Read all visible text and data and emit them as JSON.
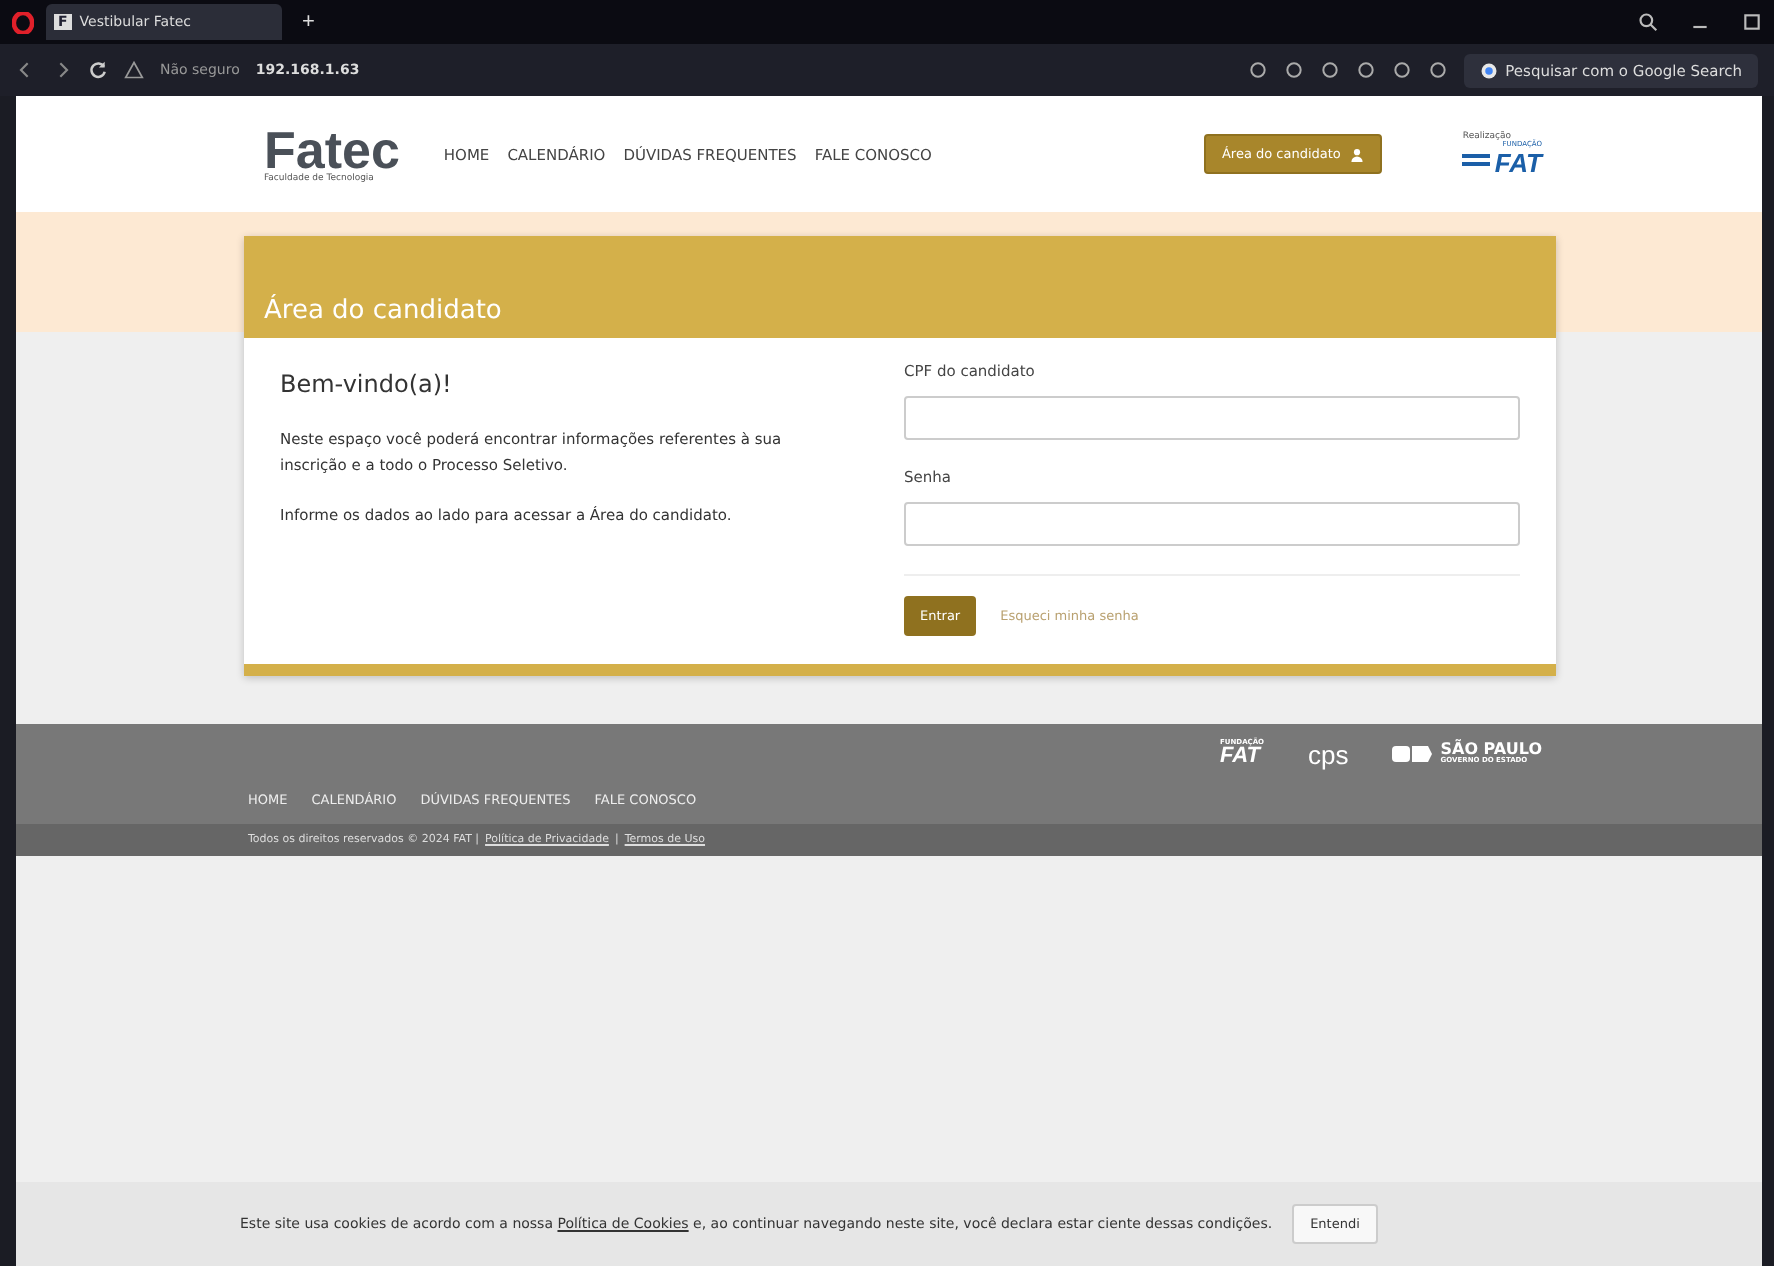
{
  "browser": {
    "tab_title": "Vestibular Fatec",
    "tab_icon": "F",
    "new_tab": "+",
    "security": "Não seguro",
    "address": "192.168.1.63",
    "search_button": "Pesquisar com o Google Search"
  },
  "header": {
    "logo": "Fatec",
    "logo_subtitle": "Faculdade de Tecnologia",
    "nav": [
      "HOME",
      "CALENDÁRIO",
      "DÚVIDAS FREQUENTES",
      "FALE CONOSCO"
    ],
    "candidate_button": "Área do candidato",
    "sponsor_label": "Realização",
    "sponsor_logo": "FAT",
    "sponsor_logo_top": "FUNDAÇÃO"
  },
  "card": {
    "title": "Área do candidato",
    "welcome": "Bem-vindo(a)!",
    "paragraphs": [
      "Neste espaço você poderá encontrar informações referentes à sua inscrição e a todo o Processo Seletivo.",
      "Informe os dados ao lado para acessar a Área do candidato."
    ],
    "fields": [
      {
        "label": "CPF do candidato"
      },
      {
        "label": "Senha"
      }
    ],
    "submit": "Entrar",
    "forgot_link": "Esqueci minha senha"
  },
  "footer": {
    "logos": [
      {
        "kind": "fat",
        "text": "FAT",
        "small": "FUNDAÇÃO"
      },
      {
        "kind": "cps",
        "text": "cps"
      },
      {
        "kind": "sp",
        "text": "SÃO PAULO",
        "small": "GOVERNO DO ESTADO"
      }
    ],
    "nav": [
      "HOME",
      "CALENDÁRIO",
      "DÚVIDAS FREQUENTES",
      "FALE CONOSCO"
    ],
    "copyright": "Todos os direitos reservados © 2024 FAT |",
    "links": [
      "Política de Privacidade",
      "Termos de Uso"
    ],
    "separator": "|"
  },
  "cookie_bar": {
    "text_before": "Este site usa cookies de acordo com a nossa",
    "link": "Política de Cookies",
    "text_after": "e, ao continuar navegando neste site, você declara estar ciente dessas condições.",
    "button": "Entendi"
  }
}
